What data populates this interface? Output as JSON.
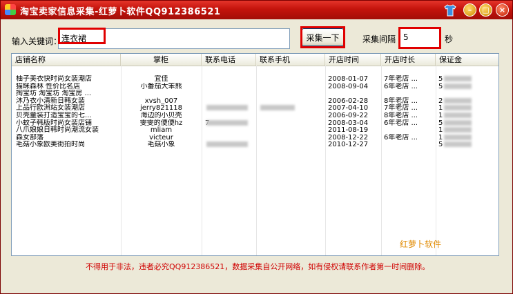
{
  "window": {
    "title": "淘宝卖家信息采集-红萝卜软件QQ912386521",
    "controls": {
      "minimize": "–",
      "maximize": "□",
      "close": "×"
    }
  },
  "search": {
    "keyword_label": "输入关键词：",
    "keyword_value": "连衣裙",
    "collect_button": "采集一下",
    "interval_label": "采集间隔",
    "interval_value": "5",
    "interval_unit": "秒"
  },
  "table": {
    "columns": [
      "店铺名称",
      "掌柜",
      "联系电话",
      "联系手机",
      "开店时间",
      "开店时长",
      "保证金"
    ],
    "rows": [
      {
        "shop": "柚子美衣快时尚女装潮店",
        "owner": "宜佳",
        "phone": "",
        "mobile": "",
        "date": "2008-01-07",
        "duration": "7年老店 ...",
        "deposit": "5"
      },
      {
        "shop": "猫眯森林  性价比名店",
        "owner": "小番茄大笨熊",
        "phone": "",
        "mobile": "",
        "date": "2008-09-04",
        "duration": "6年老店 ...",
        "deposit": "5"
      },
      {
        "shop": "掏宝坊 淘宝坊 淘宝房 ...",
        "owner": "",
        "phone": "",
        "mobile": "",
        "date": "",
        "duration": "",
        "deposit": ""
      },
      {
        "shop": "沐乃衣小清新日韩女装",
        "owner": "xvsh_007",
        "phone": "",
        "mobile": "",
        "date": "2006-02-28",
        "duration": "8年老店 ...",
        "deposit": "2"
      },
      {
        "shop": "上品行欧洲站女装潮店",
        "owner": "jerry821118",
        "phone": "",
        "mobile": "",
        "date": "2007-04-10",
        "duration": "7年老店 ...",
        "deposit": "1"
      },
      {
        "shop": "贝壳童装打造宝宝的七...",
        "owner": "海边的小贝壳",
        "phone": "",
        "mobile": "",
        "date": "2006-09-22",
        "duration": "8年老店 ...",
        "deposit": "1"
      },
      {
        "shop": "小蚊子韩版时尚女装店铺",
        "owner": "雯雯的便便hz",
        "phone": "7",
        "mobile": "",
        "date": "2008-03-04",
        "duration": "6年老店 ...",
        "deposit": "5"
      },
      {
        "shop": "八爪娘娘日韩时尚潮流女装",
        "owner": "mliam",
        "phone": "",
        "mobile": "",
        "date": "2011-08-19",
        "duration": "",
        "deposit": "1"
      },
      {
        "shop": "森女部落",
        "owner": "victeur",
        "phone": "",
        "mobile": "",
        "date": "2008-12-22",
        "duration": "6年老店 ...",
        "deposit": "1"
      },
      {
        "shop": "毛菇小象欧美街拍时尚",
        "owner": "毛菇小象",
        "phone": "",
        "mobile": "",
        "date": "2010-12-27",
        "duration": "",
        "deposit": "5"
      }
    ]
  },
  "watermark": "红萝卜软件",
  "footer_notice": "不得用于非法，违者必究QQ912386521，数据采集自公开网络，如有侵权请联系作者第一时间删除。",
  "colors": {
    "titlebar": "#c4130c",
    "highlight_box": "#e00000",
    "notice": "#d00000",
    "watermark": "#e08a00"
  }
}
